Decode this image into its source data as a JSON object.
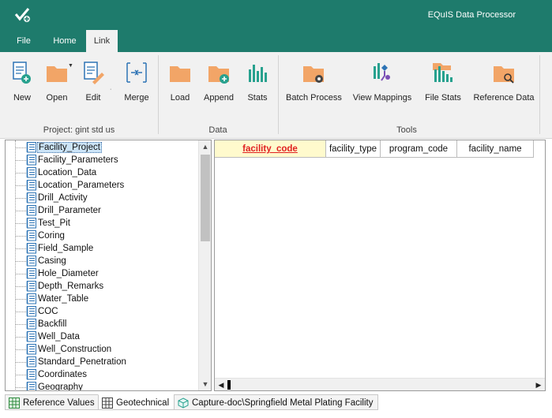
{
  "app": {
    "title": "EQuIS Data Processor"
  },
  "tabs": {
    "file": "File",
    "home": "Home",
    "link": "Link"
  },
  "ribbon": {
    "project_group": {
      "label": "Project: gint std us",
      "buttons": {
        "new": "New",
        "open": "Open",
        "edit": "Edit",
        "merge": "Merge"
      }
    },
    "data_group": {
      "label": "Data",
      "buttons": {
        "load": "Load",
        "append": "Append",
        "stats": "Stats"
      }
    },
    "tools_group": {
      "label": "Tools",
      "buttons": {
        "batch_process": "Batch Process",
        "view_mappings": "View Mappings",
        "file_stats": "File Stats",
        "reference_data": "Reference Data"
      }
    }
  },
  "tree": {
    "items": [
      "Facility_Project",
      "Facility_Parameters",
      "Location_Data",
      "Location_Parameters",
      "Drill_Activity",
      "Drill_Parameter",
      "Test_Pit",
      "Coring",
      "Field_Sample",
      "Casing",
      "Hole_Diameter",
      "Depth_Remarks",
      "Water_Table",
      "COC",
      "Backfill",
      "Well_Data",
      "Well_Construction",
      "Standard_Penetration",
      "Coordinates",
      "Geography"
    ],
    "selected": "Facility_Project"
  },
  "grid": {
    "columns": [
      "facility_code",
      "facility_type",
      "program_code",
      "facility_name"
    ],
    "key_column": "facility_code"
  },
  "bottom_tabs": {
    "reference_values": "Reference Values",
    "geotechnical": "Geotechnical",
    "capture": "Capture-doc\\Springfield Metal Plating Facility"
  },
  "colors": {
    "title_bar": "#1e7b6c",
    "ribbon_bg": "#f1f1f1",
    "icon_orange": "#f2a567",
    "icon_teal": "#27a18e",
    "key_column_text": "#e02020"
  }
}
